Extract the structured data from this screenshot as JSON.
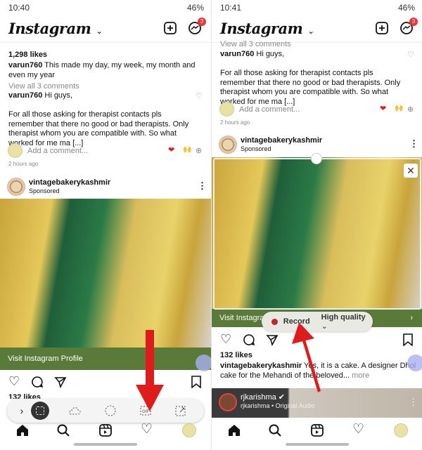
{
  "left": {
    "status": {
      "time": "10:40",
      "battery": "46%"
    },
    "app_title": "Instagram",
    "messenger_badge": "3",
    "likes": "1,298 likes",
    "caption_user": "varun760",
    "caption_text": "This made my day, my week, my month and even my year",
    "view_comments": "View all 3 comments",
    "comment_user": "varun760",
    "comment_text1": "Hi guys,",
    "comment_text2": "For all those asking for therapist contacts pls remember that there no good or bad therapists. Only therapist whom you are compatible with. So what worked for me ma [...]",
    "add_comment": "Add a comment...",
    "time_ago": "2 hours ago",
    "post_user": "vintagebakerykashmir",
    "sponsored": "Sponsored",
    "visit_profile": "Visit Instagram Profile",
    "likes2": "132 likes",
    "toolbar": {
      "items": [
        "expand",
        "rectangle-select",
        "freeform-select",
        "oval-select",
        "gif-record",
        "pin-to-screen"
      ],
      "selected": "rectangle-select"
    }
  },
  "right": {
    "status": {
      "time": "10:41",
      "battery": "46%"
    },
    "app_title": "Instagram",
    "messenger_badge": "3",
    "view_comments": "View all 3 comments",
    "comment_user": "varun760",
    "comment_text1": "Hi guys,",
    "comment_text2": "For all those asking for therapist contacts pls remember that there no good or bad therapists. Only therapist whom you are compatible with. So what worked for me ma [...]",
    "add_comment": "Add a comment...",
    "time_ago": "2 hours ago",
    "post_user": "vintagebakerykashmir",
    "sponsored": "Sponsored",
    "visit_profile": "Visit Instagra",
    "record_label": "Record",
    "quality_label": "High quality",
    "likes": "132 likes",
    "caption_user": "vintagebakerykashmir",
    "caption_text": "Yes, it is a cake. A designer Dhol cake for the Mehandi of the beloved...",
    "more": "more",
    "reel_user": "rjkarishma",
    "reel_audio": "rjkarishma • Original Audio"
  },
  "colors": {
    "accent_red": "#e02020",
    "banner_green": "#5a7a3a",
    "badge": "#e33333"
  }
}
